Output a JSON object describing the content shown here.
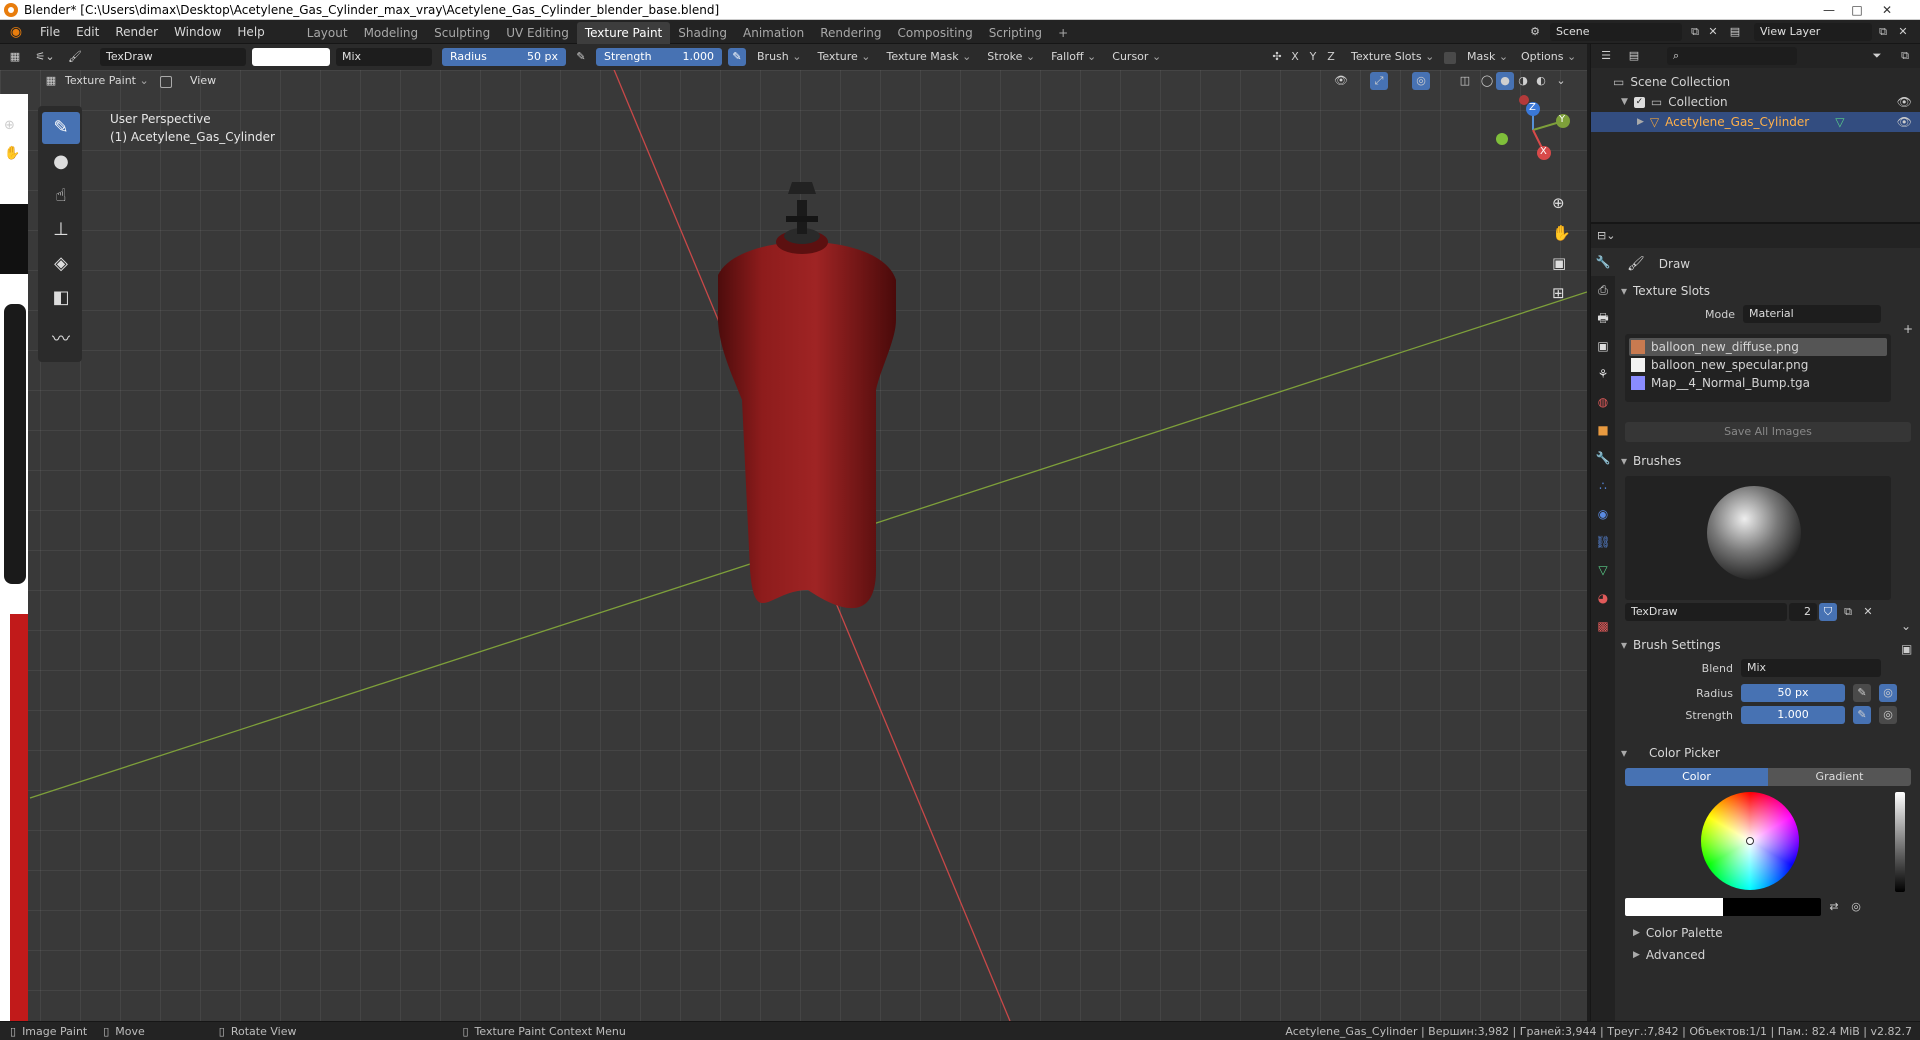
{
  "window": {
    "title": "Blender* [C:\\Users\\dimax\\Desktop\\Acetylene_Gas_Cylinder_max_vray\\Acetylene_Gas_Cylinder_blender_base.blend]",
    "minimize": "—",
    "maximize": "□",
    "close": "✕"
  },
  "menu": [
    "File",
    "Edit",
    "Render",
    "Window",
    "Help"
  ],
  "workspaces": [
    "Layout",
    "Modeling",
    "Sculpting",
    "UV Editing",
    "Texture Paint",
    "Shading",
    "Animation",
    "Rendering",
    "Compositing",
    "Scripting"
  ],
  "active_workspace": "Texture Paint",
  "add_workspace": "+",
  "scene": {
    "label": "Scene",
    "view_layer": "View Layer"
  },
  "toolheader": {
    "brush_name": "TexDraw",
    "blend": "Mix",
    "radius_label": "Radius",
    "radius_value": "50 px",
    "strength_label": "Strength",
    "strength_value": "1.000",
    "menus": [
      "Brush",
      "Texture",
      "Texture Mask",
      "Stroke",
      "Falloff",
      "Cursor"
    ],
    "axis": [
      "X",
      "Y",
      "Z"
    ],
    "right_menus": [
      "Texture Slots",
      "Mask",
      "Options"
    ]
  },
  "viewport": {
    "mode": "Texture Paint",
    "view_menu": "View",
    "overlay_line1": "User Perspective",
    "overlay_line2": "(1) Acetylene_Gas_Cylinder",
    "gizmo": {
      "z": "Z",
      "y": "Y",
      "x": "X"
    },
    "colors": {
      "cylinder": "#8a1a1a",
      "x_axis": "#c84848",
      "y_axis": "#7ea03a"
    }
  },
  "outliner": {
    "root": "Scene Collection",
    "collection": "Collection",
    "object": "Acetylene_Gas_Cylinder"
  },
  "properties": {
    "tool_name": "Draw",
    "texture_slots": {
      "title": "Texture Slots",
      "mode_label": "Mode",
      "mode_value": "Material",
      "slots": [
        {
          "name": "balloon_new_diffuse.png",
          "color": "#c87a50"
        },
        {
          "name": "balloon_new_specular.png",
          "color": "#f2f2f2"
        },
        {
          "name": "Map__4_Normal_Bump.tga",
          "color": "#8a8cff"
        }
      ],
      "save_all": "Save All Images"
    },
    "brushes": {
      "title": "Brushes",
      "brush_name": "TexDraw",
      "users": "2"
    },
    "brush_settings": {
      "title": "Brush Settings",
      "blend_label": "Blend",
      "blend_value": "Mix",
      "radius_label": "Radius",
      "radius_value": "50 px",
      "strength_label": "Strength",
      "strength_value": "1.000"
    },
    "color_picker": {
      "title": "Color Picker",
      "tab_color": "Color",
      "tab_gradient": "Gradient"
    },
    "color_palette": "Color Palette",
    "advanced": "Advanced"
  },
  "statusbar": {
    "left1": "Image Paint",
    "left2": "Move",
    "left3": "Rotate View",
    "left4": "Texture Paint Context Menu",
    "right": "Acetylene_Gas_Cylinder | Вершин:3,982 | Граней:3,944 | Треуг.:7,842 | Объектов:1/1 | Пам.: 82.4 MiB | v2.82.7"
  }
}
